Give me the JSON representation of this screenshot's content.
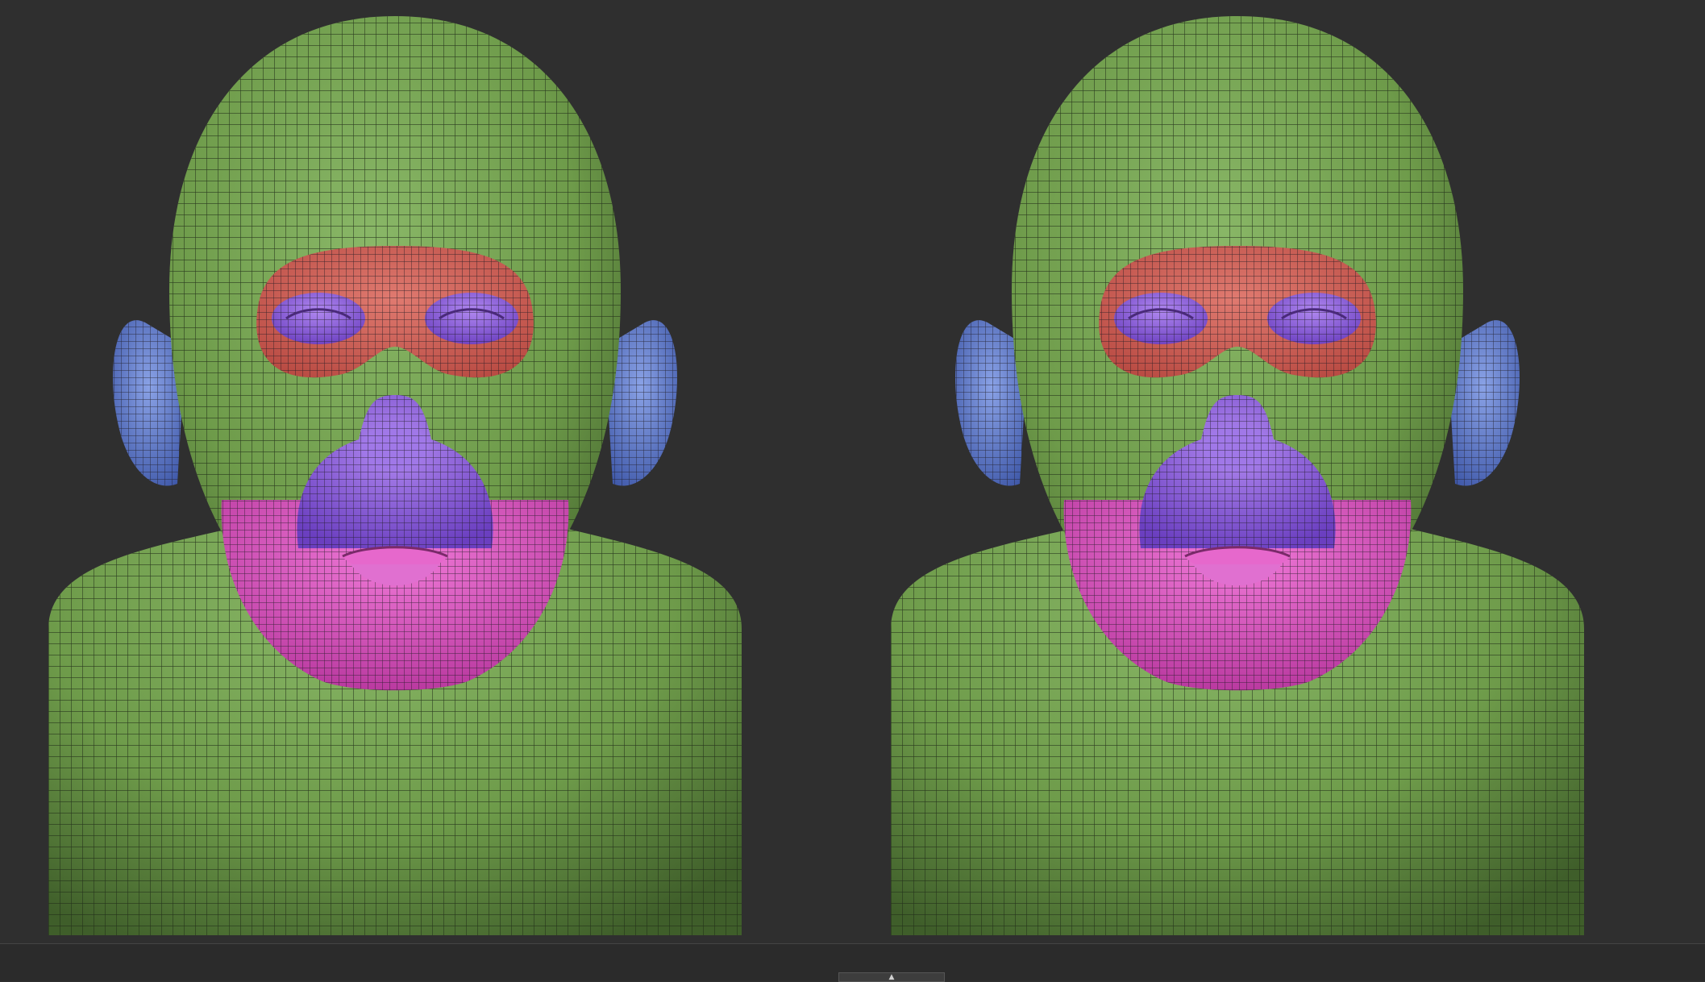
{
  "viewport": {
    "background_color": "#2f2f2f",
    "model_count": 2,
    "polygroup_colors": {
      "skin": "#6e9b4a",
      "eye_mask": "#d45f55",
      "eye_sockets": "#9b64d6",
      "muzzle": "#8f5be0",
      "jaw": "#d94fc0",
      "ears": "#5f7ed0",
      "wireframe": "#1e2a17"
    }
  },
  "icons": {
    "handle": "chevron-up-icon"
  }
}
